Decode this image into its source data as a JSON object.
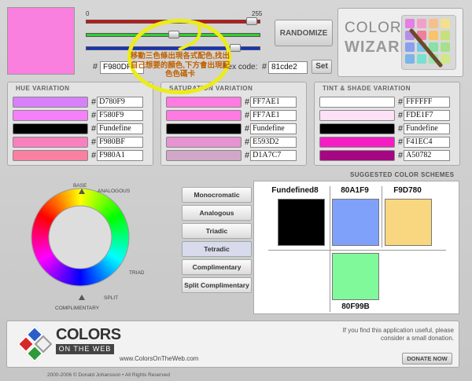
{
  "preview": {
    "color": "#F980DF"
  },
  "sliders": {
    "min_label": "0",
    "max_label": "255",
    "tracks": [
      {
        "name": "red",
        "color": "#cc1111",
        "value": 249
      },
      {
        "name": "green",
        "color": "#33cc33",
        "value": 128
      },
      {
        "name": "blue",
        "color": "#1133cc",
        "value": 223
      }
    ]
  },
  "buttons": {
    "randomize": "RANDOMIZE",
    "set": "Set",
    "donate": "DONATE NOW"
  },
  "logo": {
    "line1": "COLOR",
    "line2": "WIZARD"
  },
  "hex": {
    "hash": "#",
    "current_value": "F980DF",
    "label": "hex code:",
    "input_value": "81cde2"
  },
  "annotation": {
    "text": "移動三色條出現各式配色,找出自己想要的顏色,下方會出現配色色碼卡",
    "color": "#ecec1a"
  },
  "panels": {
    "hue": {
      "title": "HUE VARIATION",
      "rows": [
        {
          "color": "#D780F9",
          "hex": "D780F9"
        },
        {
          "color": "#F580F9",
          "hex": "F580F9"
        },
        {
          "color": "#000000",
          "hex": "Fundefine"
        },
        {
          "color": "#F980BF",
          "hex": "F980BF"
        },
        {
          "color": "#F980A1",
          "hex": "F980A1"
        }
      ]
    },
    "saturation": {
      "title": "SATURATION VARIATION",
      "rows": [
        {
          "color": "#FF7AE1",
          "hex": "FF7AE1"
        },
        {
          "color": "#FF7AE1",
          "hex": "FF7AE1"
        },
        {
          "color": "#000000",
          "hex": "Fundefine"
        },
        {
          "color": "#E593D2",
          "hex": "E593D2"
        },
        {
          "color": "#D1A7C7",
          "hex": "D1A7C7"
        }
      ]
    },
    "tint": {
      "title": "TINT & SHADE VARIATION",
      "rows": [
        {
          "color": "#FFFFFF",
          "hex": "FFFFFF"
        },
        {
          "color": "#FDE1F7",
          "hex": "FDE1F7"
        },
        {
          "color": "#000000",
          "hex": "Fundefine"
        },
        {
          "color": "#F41EC4",
          "hex": "F41EC4"
        },
        {
          "color": "#A50782",
          "hex": "A50782"
        }
      ]
    }
  },
  "wheel": {
    "labels": [
      "BASE",
      "ANALOGOUS",
      "TRIAD",
      "SPLIT",
      "COMPLIMENTARY"
    ]
  },
  "schemes": {
    "buttons": [
      "Monocromatic",
      "Analogous",
      "Triadic",
      "Tetradic",
      "Complimentary",
      "Split Complimentary"
    ],
    "active": "Tetradic",
    "title": "SUGGESTED COLOR SCHEMES",
    "colors": [
      {
        "label": "Fundefined8",
        "color": "#000000"
      },
      {
        "label": "80A1F9",
        "color": "#80A1F9"
      },
      {
        "label": "F9D780",
        "color": "#F9D780"
      },
      {
        "label": "80F99B",
        "color": "#80F99B"
      }
    ]
  },
  "footer": {
    "brand_line1": "COLORS",
    "brand_line2": "ON THE WEB",
    "url": "www.ColorsOnTheWeb.com",
    "message": "If you find this application useful, please consider a small donation.",
    "copyright": "2000-2006 © Donald Johansson • All Rights Reserved"
  }
}
